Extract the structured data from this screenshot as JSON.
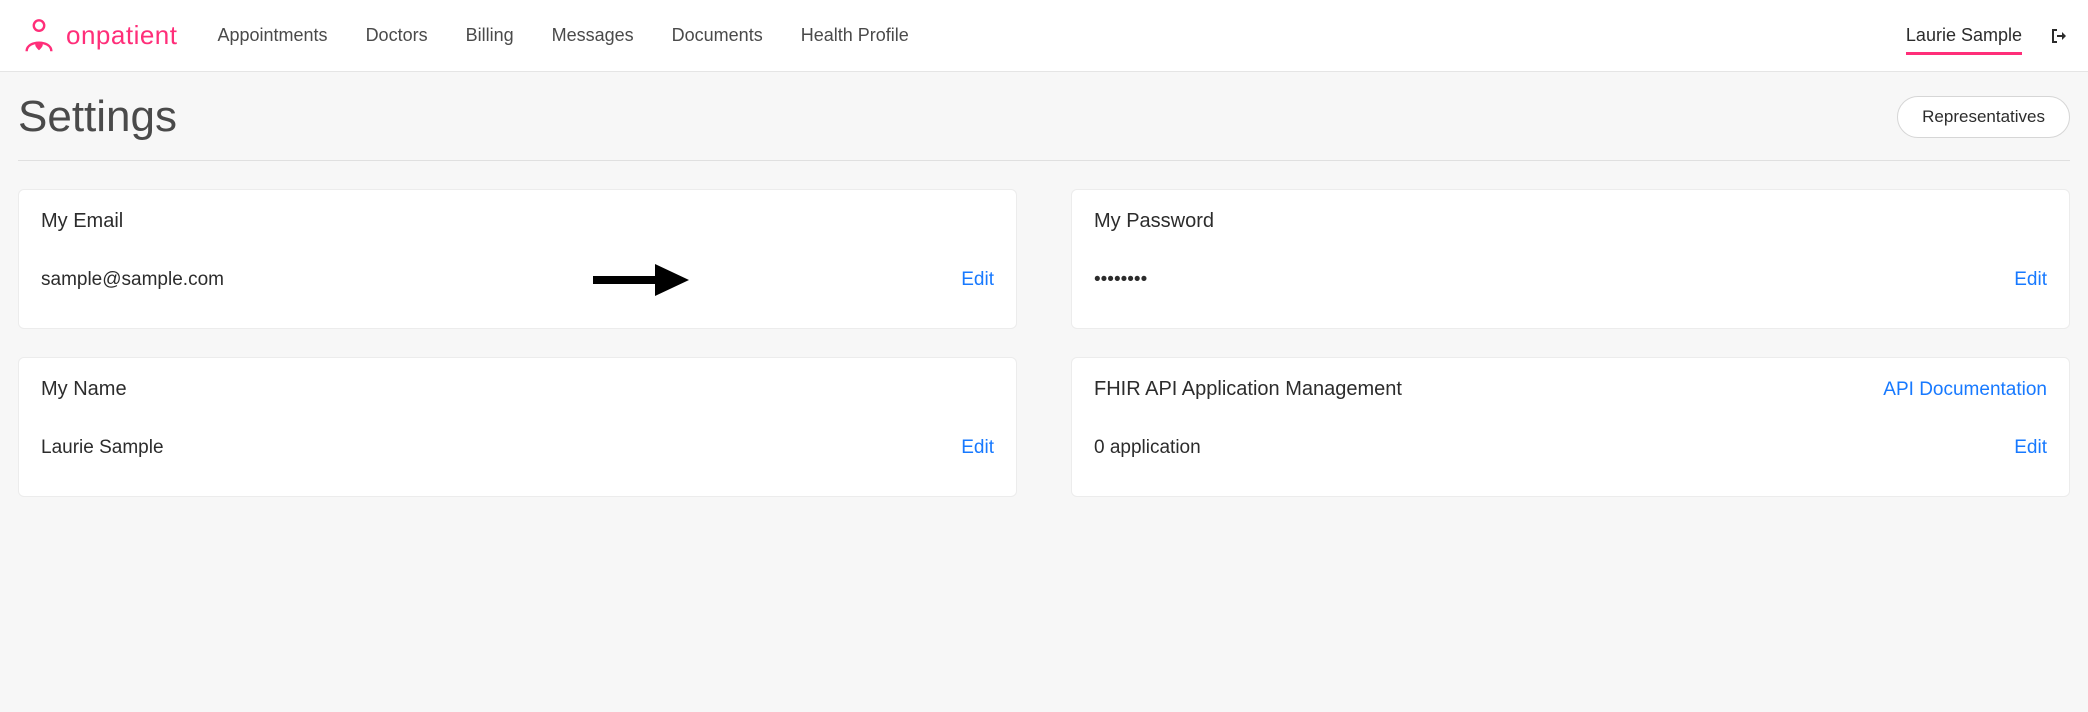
{
  "brand": {
    "name": "onpatient"
  },
  "nav": {
    "items": [
      {
        "label": "Appointments"
      },
      {
        "label": "Doctors"
      },
      {
        "label": "Billing"
      },
      {
        "label": "Messages"
      },
      {
        "label": "Documents"
      },
      {
        "label": "Health Profile"
      }
    ]
  },
  "user": {
    "display_name": "Laurie Sample"
  },
  "page": {
    "title": "Settings",
    "representatives_label": "Representatives"
  },
  "cards": {
    "email": {
      "title": "My Email",
      "value": "sample@sample.com",
      "edit_label": "Edit"
    },
    "password": {
      "title": "My Password",
      "value": "••••••••",
      "edit_label": "Edit"
    },
    "name": {
      "title": "My Name",
      "value": "Laurie Sample",
      "edit_label": "Edit"
    },
    "fhir": {
      "title": "FHIR API Application Management",
      "doc_label": "API Documentation",
      "value": "0 application",
      "edit_label": "Edit"
    }
  }
}
